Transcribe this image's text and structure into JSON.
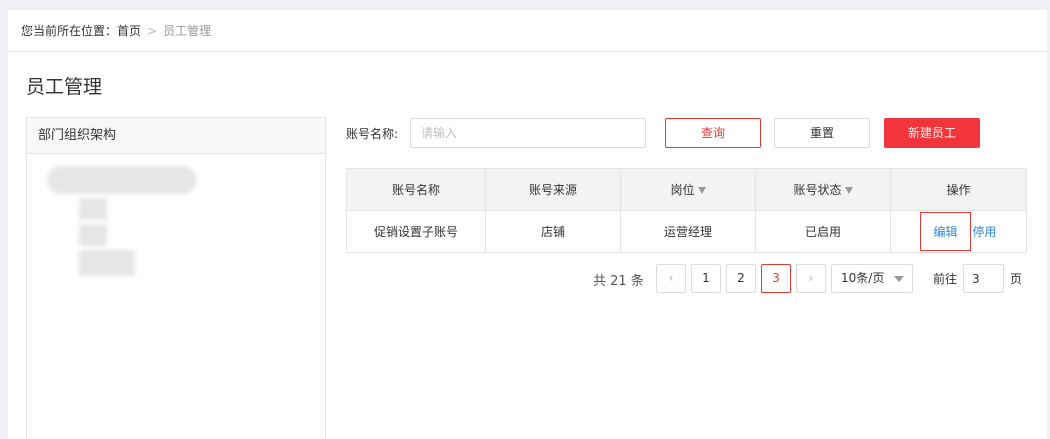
{
  "breadcrumb": {
    "prefix": "您当前所在位置：",
    "home": "首页",
    "separator": ">",
    "current": "员工管理"
  },
  "page_title": "员工管理",
  "tree": {
    "header": "部门组织架构"
  },
  "search": {
    "label": "账号名称:",
    "placeholder": "请输入",
    "value": ""
  },
  "buttons": {
    "query": "查询",
    "reset": "重置",
    "new_employee": "新建员工"
  },
  "table": {
    "columns": [
      "账号名称",
      "账号来源",
      "岗位",
      "账号状态",
      "操作"
    ],
    "rows": [
      {
        "name": "促销设置子账号",
        "source": "店铺",
        "position": "运营经理",
        "status": "已启用",
        "edit": "编辑",
        "disable": "停用"
      }
    ]
  },
  "pagination": {
    "total_text": "共 21 条",
    "pages": [
      "1",
      "2",
      "3"
    ],
    "current_page": "3",
    "prev_icon": "chevron-left-icon",
    "next_icon": "chevron-right-icon",
    "prev_glyph": "‹",
    "next_glyph": "›",
    "page_size": "10条/页",
    "goto_label": "前往",
    "goto_value": "3",
    "page_suffix": "页"
  },
  "colors": {
    "accent_red": "#f2353a",
    "link_blue": "#2e86de",
    "status_green": "#2aa84f"
  }
}
